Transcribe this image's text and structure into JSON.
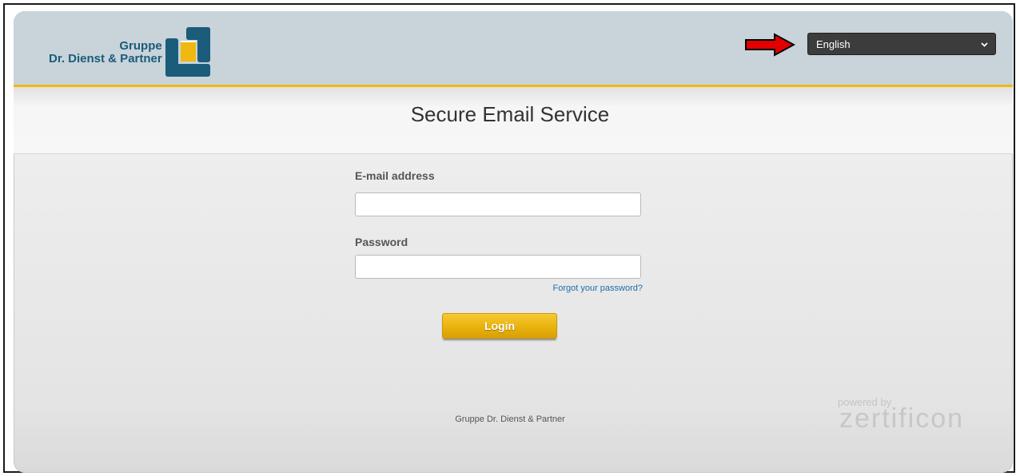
{
  "header": {
    "logo_line1": "Gruppe",
    "logo_line2": "Dr. Dienst & Partner",
    "language": {
      "selected": "English"
    }
  },
  "main": {
    "title": "Secure Email Service",
    "form": {
      "email_label": "E-mail address",
      "email_value": "",
      "password_label": "Password",
      "password_value": "",
      "forgot_link": "Forgot your password?",
      "login_button": "Login"
    }
  },
  "footer": {
    "company": "Gruppe Dr. Dienst & Partner",
    "powered_by_label": "powered by",
    "powered_by_brand": "zertificon"
  },
  "colors": {
    "accent_gold": "#f0b90f",
    "brand_blue": "#1a5c7a",
    "link_blue": "#1f6ea8",
    "arrow_red": "#e00000"
  },
  "icons": {
    "logo": "company-logo-icon",
    "arrow": "red-arrow-icon",
    "chevron": "chevron-down-icon"
  }
}
